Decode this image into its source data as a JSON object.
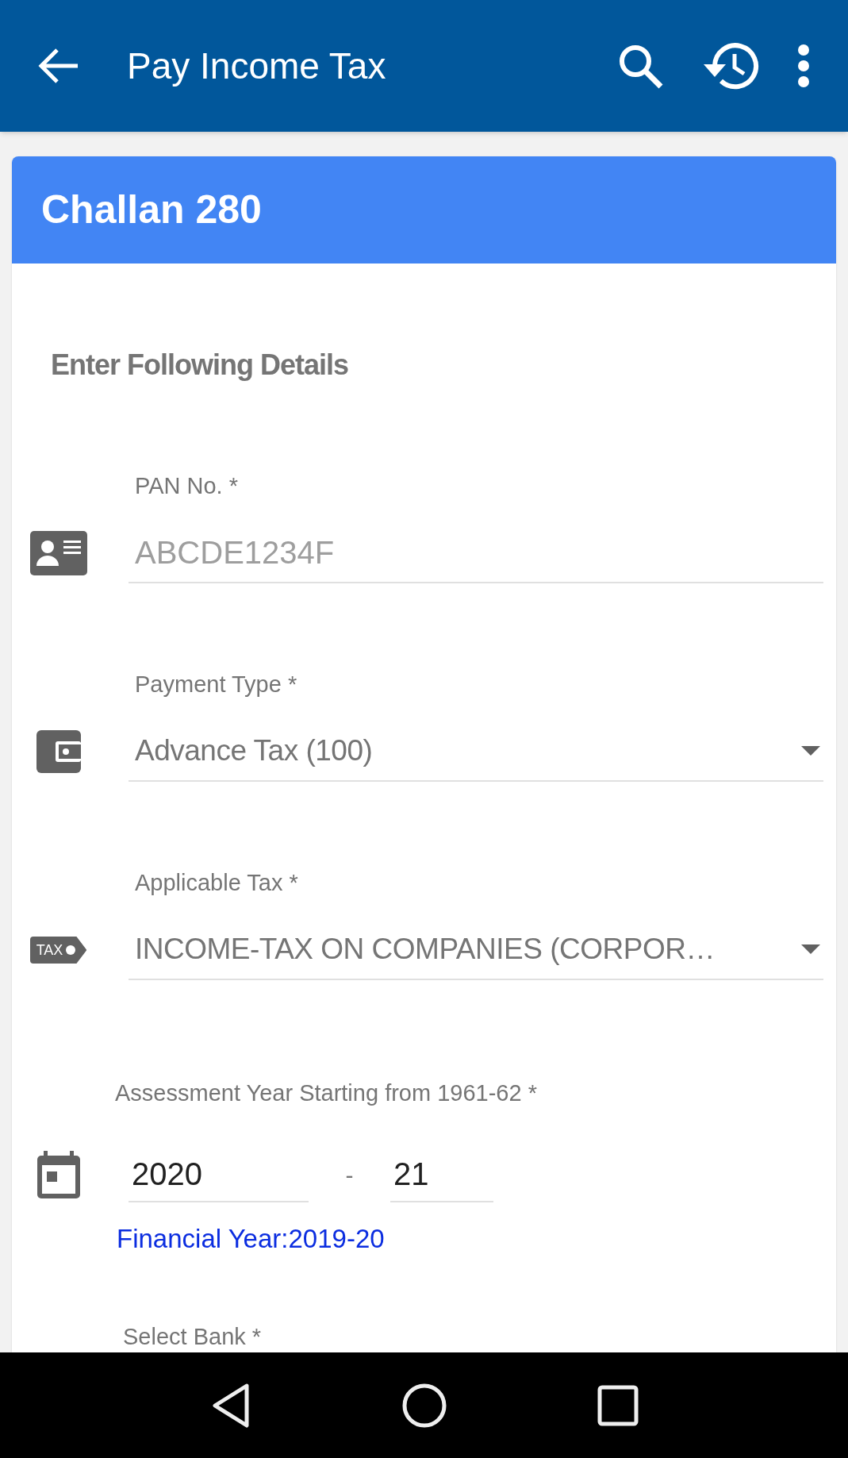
{
  "app_bar": {
    "title": "Pay Income Tax"
  },
  "card": {
    "title": "Challan 280",
    "section_heading": "Enter Following Details",
    "fields": [
      {
        "kind": "text",
        "label": "PAN No. *",
        "placeholder": "ABCDE1234F"
      },
      {
        "kind": "select",
        "label": "Payment Type *",
        "value": "Advance Tax (100)"
      },
      {
        "kind": "select",
        "icon_text": "TAX",
        "label": "Applicable Tax *",
        "value": "INCOME-TAX ON COMPANIES (CORPOR…"
      }
    ],
    "assessment": {
      "label": "Assessment Year Starting from 1961-62 *",
      "start": "2020",
      "separator": "-",
      "end": "21",
      "note": "Financial Year:2019-20"
    },
    "next_label": "Select Bank *"
  }
}
